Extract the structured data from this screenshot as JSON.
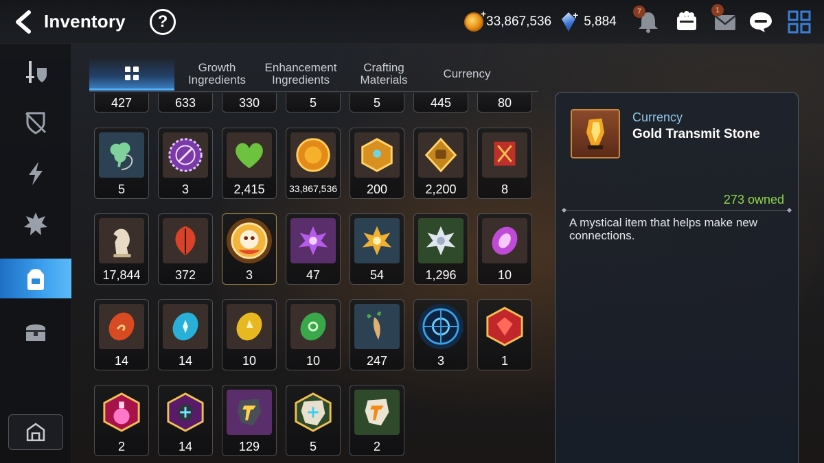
{
  "header": {
    "title": "Inventory",
    "help_label": "?",
    "gold": "33,867,536",
    "crystals": "5,884",
    "notifications_badge": "7",
    "mail_badge": "1",
    "gold_plus": "+",
    "crystals_plus": "+"
  },
  "sidebar": {
    "items": [
      {
        "icon": "sword-shield-icon"
      },
      {
        "icon": "broken-shield-icon"
      },
      {
        "icon": "lightning-icon"
      },
      {
        "icon": "spiky-artifact-icon"
      },
      {
        "icon": "backpack-icon"
      },
      {
        "icon": "treasure-chest-icon"
      }
    ],
    "bottom_icon": "sanctuary-icon"
  },
  "tabs": [
    {
      "label": "",
      "icon": "grid-icon"
    },
    {
      "label": "Growth Ingredients"
    },
    {
      "label": "Enhancement Ingredients"
    },
    {
      "label": "Crafting Materials"
    },
    {
      "label": "Currency"
    }
  ],
  "items": [
    {
      "count": "427"
    },
    {
      "count": "633"
    },
    {
      "count": "330"
    },
    {
      "count": "5"
    },
    {
      "count": "5"
    },
    {
      "count": "445"
    },
    {
      "count": "80"
    },
    {
      "count": "5",
      "icon": "clover-pendant-icon"
    },
    {
      "count": "3",
      "icon": "purple-seal-icon"
    },
    {
      "count": "2,415",
      "icon": "green-heart-icon"
    },
    {
      "count": "33,867,536",
      "icon": "gold-coin-icon"
    },
    {
      "count": "200",
      "icon": "gold-emblem-icon"
    },
    {
      "count": "2,200",
      "icon": "fist-emblem-icon"
    },
    {
      "count": "8",
      "icon": "red-banner-icon"
    },
    {
      "count": "17,844",
      "icon": "chess-knight-icon"
    },
    {
      "count": "372",
      "icon": "red-leaf-icon"
    },
    {
      "count": "3",
      "icon": "hero-portrait-icon"
    },
    {
      "count": "47",
      "icon": "purple-flower-icon"
    },
    {
      "count": "54",
      "icon": "gold-flower-icon"
    },
    {
      "count": "1,296",
      "icon": "silver-flower-icon"
    },
    {
      "count": "10",
      "icon": "purple-rune-icon"
    },
    {
      "count": "14",
      "icon": "red-rune-icon"
    },
    {
      "count": "14",
      "icon": "cyan-rune-icon"
    },
    {
      "count": "10",
      "icon": "yellow-rune-icon"
    },
    {
      "count": "10",
      "icon": "green-rune-icon"
    },
    {
      "count": "247",
      "icon": "root-herb-icon"
    },
    {
      "count": "3",
      "icon": "blue-sigil-icon"
    },
    {
      "count": "1",
      "icon": "red-gem-icon"
    },
    {
      "count": "2",
      "icon": "potion-icon"
    },
    {
      "count": "14",
      "icon": "dark-crystal-icon"
    },
    {
      "count": "129",
      "icon": "gold-stone-icon"
    },
    {
      "count": "5",
      "icon": "cyan-stone-icon"
    },
    {
      "count": "2",
      "icon": "orange-stone-icon"
    }
  ],
  "detail": {
    "category": "Currency",
    "name": "Gold Transmit Stone",
    "owned": "273 owned",
    "description": "A mystical item that helps make new connections.",
    "icon": "gold-transmit-stone-icon"
  },
  "colors": {
    "accent": "#3ca0ee",
    "owned_text": "#8fd64a",
    "category_text": "#8ec7e8"
  }
}
